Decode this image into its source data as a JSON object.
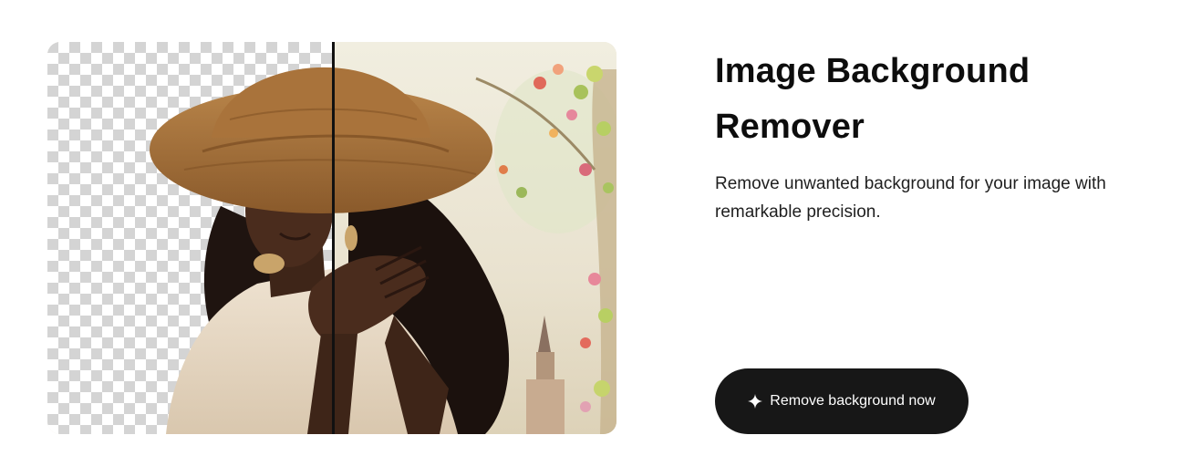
{
  "hero": {
    "title": "Image Background Remover",
    "description": "Remove unwanted background for your image with remarkable precision."
  },
  "comparison": {
    "left_panel": "transparent-background",
    "right_panel": "original-background",
    "icons": {
      "checker": "transparency-checkerboard",
      "divider": "comparison-slider"
    },
    "colors": {
      "checker_light": "#ffffff",
      "checker_dark": "#d4d4d4",
      "background_scene": "#ece7d8"
    }
  },
  "cta": {
    "label": "Remove background now",
    "icon": "sparkle-icon",
    "background": "#171717",
    "text_color": "#ffffff"
  }
}
